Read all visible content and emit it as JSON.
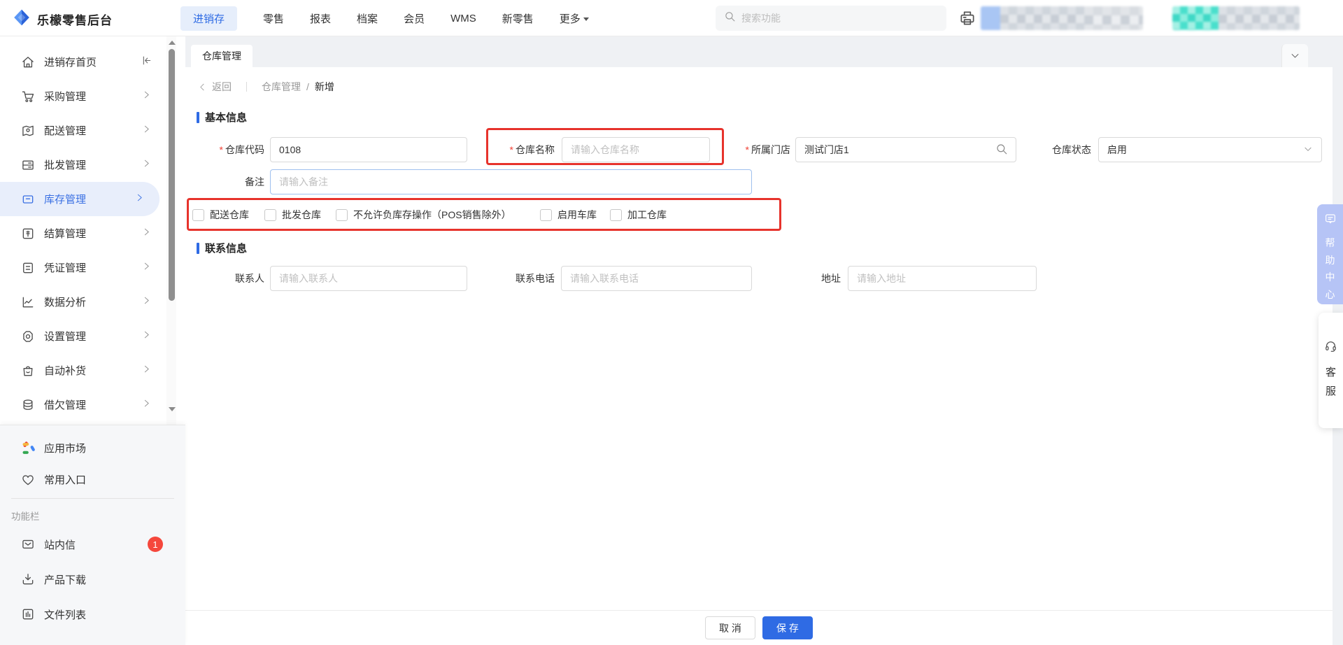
{
  "topbar": {
    "logo_text": "乐檬零售后台",
    "nav": [
      {
        "label": "进销存",
        "active": true
      },
      {
        "label": "零售"
      },
      {
        "label": "报表"
      },
      {
        "label": "档案"
      },
      {
        "label": "会员"
      },
      {
        "label": "WMS"
      },
      {
        "label": "新零售"
      },
      {
        "label": "更多"
      }
    ],
    "search_placeholder": "搜索功能"
  },
  "sidebar": {
    "items": [
      {
        "label": "进销存首页"
      },
      {
        "label": "采购管理"
      },
      {
        "label": "配送管理"
      },
      {
        "label": "批发管理"
      },
      {
        "label": "库存管理",
        "active": true
      },
      {
        "label": "结算管理"
      },
      {
        "label": "凭证管理"
      },
      {
        "label": "数据分析"
      },
      {
        "label": "设置管理"
      },
      {
        "label": "自动补货"
      },
      {
        "label": "借欠管理"
      }
    ],
    "shortcuts": [
      {
        "label": "应用市场"
      },
      {
        "label": "常用入口"
      }
    ],
    "section_label": "功能栏",
    "tools": [
      {
        "label": "站内信",
        "badge": "1"
      },
      {
        "label": "产品下载"
      },
      {
        "label": "文件列表"
      }
    ]
  },
  "tab": {
    "label": "仓库管理"
  },
  "breadcrumb": {
    "back": "返回",
    "parent": "仓库管理",
    "separator": "/",
    "current": "新增"
  },
  "sections": {
    "basic": "基本信息",
    "contact": "联系信息"
  },
  "form": {
    "required_mark": "*",
    "warehouse_code": {
      "label": "仓库代码",
      "value": "0108"
    },
    "warehouse_name": {
      "label": "仓库名称",
      "placeholder": "请输入仓库名称"
    },
    "store": {
      "label": "所属门店",
      "value": "测试门店1"
    },
    "status": {
      "label": "仓库状态",
      "value": "启用"
    },
    "remark": {
      "label": "备注",
      "placeholder": "请输入备注"
    },
    "checkboxes": [
      {
        "label": "配送仓库",
        "checked": false
      },
      {
        "label": "批发仓库",
        "checked": false
      },
      {
        "label": "不允许负库存操作（POS销售除外）",
        "checked": false
      },
      {
        "label": "启用车库",
        "checked": false
      },
      {
        "label": "加工仓库",
        "checked": false
      }
    ],
    "contact_person": {
      "label": "联系人",
      "placeholder": "请输入联系人"
    },
    "contact_phone": {
      "label": "联系电话",
      "placeholder": "请输入联系电话"
    },
    "address": {
      "label": "地址",
      "placeholder": "请输入地址"
    }
  },
  "footer": {
    "cancel": "取 消",
    "save": "保 存"
  },
  "side_widgets": {
    "help": "帮助中心",
    "service": "客服"
  },
  "colors": {
    "accent": "#2F6BE4",
    "active_nav_bg": "#E6EEFB",
    "annotation_red": "#E7332C",
    "badge_red": "#F5473C",
    "help_panel_blue": "#B6C4F6",
    "mosaic_teal": "#49DFCC",
    "required_red": "#F04134"
  }
}
